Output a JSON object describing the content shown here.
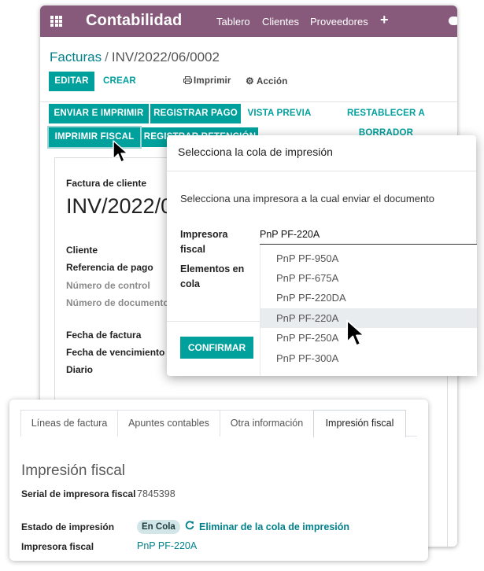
{
  "app": {
    "title": "Contabilidad",
    "nav": [
      "Tablero",
      "Clientes",
      "Proveedores"
    ]
  },
  "breadcrumb": {
    "root": "Facturas",
    "separator": "/",
    "current": "INV/2022/06/0002"
  },
  "toolbar": {
    "edit": "EDITAR",
    "create": "CREAR",
    "print": "Imprimir",
    "action": "Acción"
  },
  "status_buttons": {
    "send_print": "ENVIAR E IMPRIMIR",
    "register_payment": "REGISTRAR PAGO",
    "preview": "VISTA PREVIA",
    "reset_draft": "RESTABLECER A BORRADOR",
    "fiscal_print": "IMPRIMIR FISCAL",
    "register_retention": "REGISTRAR RETENCIÓN"
  },
  "invoice": {
    "type_label": "Factura de cliente",
    "number": "INV/2022/06/0002",
    "fields": {
      "customer": "Cliente",
      "payment_ref": "Referencia de pago",
      "control_number": "Número de control",
      "document_number": "Número de documento",
      "invoice_date": "Fecha de factura",
      "due_date": "Fecha de vencimiento",
      "journal": "Diario"
    }
  },
  "dialog": {
    "title": "Selecciona la cola de impresión",
    "description": "Selecciona una impresora a la cual enviar el documento",
    "printer_label": "Impresora fiscal",
    "queue_label": "Elementos en cola",
    "selected_printer": "PnP PF-220A",
    "options": [
      "PnP PF-950A",
      "PnP PF-675A",
      "PnP PF-220DA",
      "PnP PF-220A",
      "PnP PF-250A",
      "PnP PF-300A"
    ],
    "highlighted_option": 3,
    "confirm": "CONFIRMAR"
  },
  "tabs": {
    "items": [
      "Líneas de factura",
      "Apuntes contables",
      "Otra información",
      "Impresión fiscal"
    ],
    "active": 3
  },
  "fiscal": {
    "section_title": "Impresión fiscal",
    "serial_label": "Serial de impresora fiscal",
    "serial_value": "7845398",
    "status_label": "Estado de impresión",
    "status_value": "En Cola",
    "remove_link": "Eliminar de la cola de impresión",
    "printer_label": "Impresora fiscal",
    "printer_value": "PnP PF-220A"
  },
  "colors": {
    "brand": "#875a7b",
    "primary": "#00a09d",
    "link": "#00818a"
  }
}
